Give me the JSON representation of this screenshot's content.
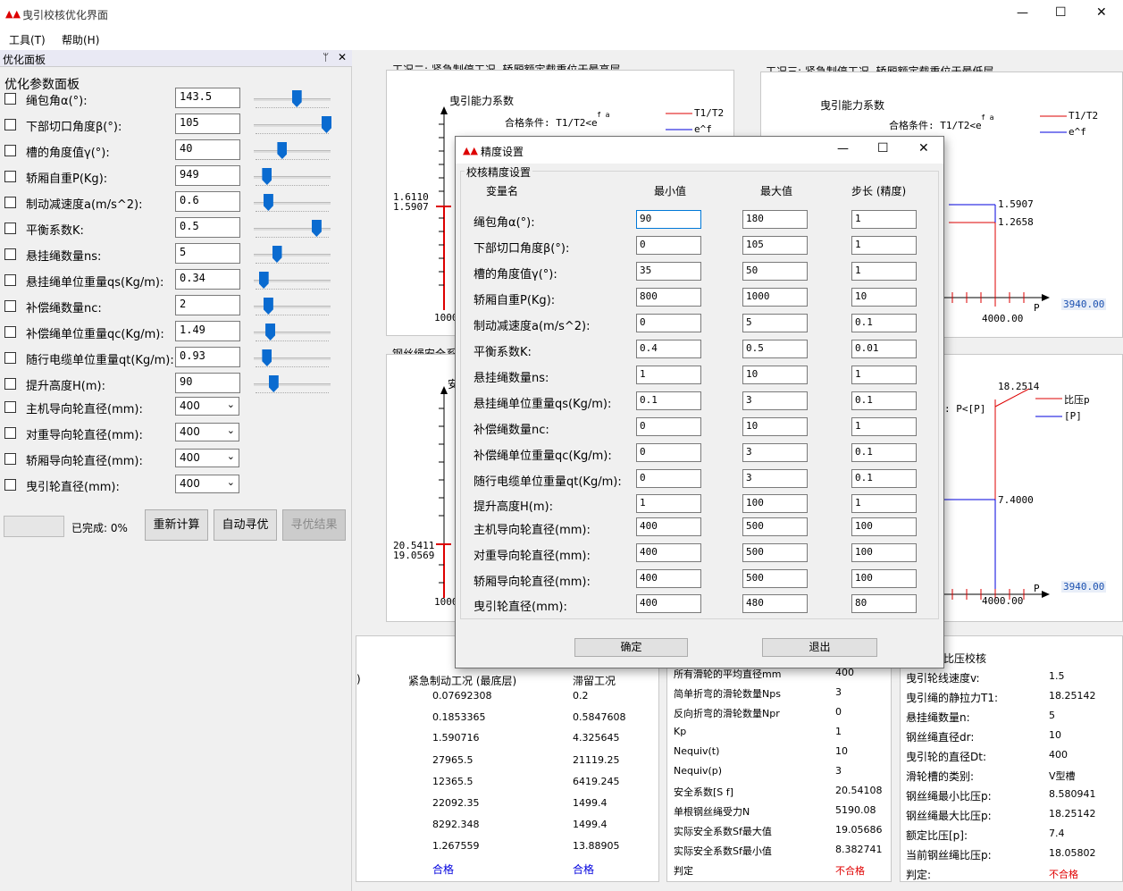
{
  "window": {
    "title": "曳引校核优化界面",
    "min": "—",
    "max": "☐",
    "close": "✕"
  },
  "menu": {
    "tools": "工具(T)",
    "help": "帮助(H)"
  },
  "panel": {
    "header": "优化面板",
    "pin": "ᛘ",
    "close": "✕",
    "group_title": "优化参数面板",
    "params": [
      {
        "label": "绳包角α(°):",
        "value": "143.5",
        "level": 0.55
      },
      {
        "label": "下部切口角度β(°):",
        "value": "105",
        "level": 1.0
      },
      {
        "label": "槽的角度值γ(°):",
        "value": "40",
        "level": 0.33
      },
      {
        "label": "轿厢自重P(Kg):",
        "value": "949",
        "level": 0.1
      },
      {
        "label": "制动减速度a(m/s^2):",
        "value": "0.6",
        "level": 0.12
      },
      {
        "label": "平衡系数K:",
        "value": "0.5",
        "level": 0.85
      },
      {
        "label": "悬挂绳数量ns:",
        "value": "5",
        "level": 0.25
      },
      {
        "label": "悬挂绳单位重量qs(Kg/m):",
        "value": "0.34",
        "level": 0.05
      },
      {
        "label": "补偿绳数量nc:",
        "value": "2",
        "level": 0.12
      },
      {
        "label": "补偿绳单位重量qc(Kg/m):",
        "value": "1.49",
        "level": 0.15
      },
      {
        "label": "随行电缆单位重量qt(Kg/m):",
        "value": "0.93",
        "level": 0.1
      },
      {
        "label": "提升高度H(m):",
        "value": "90",
        "level": 0.2
      }
    ],
    "selects": [
      {
        "label": "主机导向轮直径(mm):",
        "value": "400"
      },
      {
        "label": "对重导向轮直径(mm):",
        "value": "400"
      },
      {
        "label": "轿厢导向轮直径(mm):",
        "value": "400"
      },
      {
        "label": "曳引轮直径(mm):",
        "value": "400"
      }
    ],
    "progress_label": "已完成: 0%",
    "progress": 0,
    "btn_recalc": "重新计算",
    "btn_auto": "自动寻优",
    "btn_result": "寻优结果"
  },
  "charts": {
    "c2_title": "工况二: 紧急制停工况, 轿厢额定载重位于最高层",
    "c3_title": "工况三: 紧急制停工况, 轿厢额定载重位于最低层",
    "c4_title": "钢丝绳安全系",
    "c2_ylabel": "曳引能力系数",
    "c2_cond": "合格条件: T1/T2<e",
    "cond_sup": "f a",
    "c2_legend1": "T1/T2",
    "c2_legend2": "e^f",
    "c2_v1": "1.6110",
    "c2_v2": "1.5907",
    "c2_xtick": "1000",
    "c3_ylabel": "曳引能力系数",
    "c3_cond": "合格条件: T1/T2<e",
    "c3_legend1": "T1/T2",
    "c3_legend2": "e^f",
    "c3_v1": "1.5907",
    "c3_v2": "1.2658",
    "c3_xtick": "4000.00",
    "c3_xlabel": "P",
    "c3_side": "3940.00",
    "c4_v1": "20.5411",
    "c4_v2": "19.0569",
    "c4_xtick": "1000",
    "c4_ylabel": "安",
    "c5_v1": "18.2514",
    "c5_v2": "7.4000",
    "c5_cond": ": P<[P]",
    "c5_legend1": "比压p",
    "c5_legend2": "[P]",
    "c5_xtick": "4000.00",
    "c5_xlabel": "P",
    "c5_side": "3940.00"
  },
  "table1": {
    "hdr_a": ")",
    "hdr_b": "紧急制动工况 (最底层)",
    "hdr_c": "滞留工况",
    "col_b": [
      "0.07692308",
      "0.1853365",
      "1.590716",
      "27965.5",
      "12365.5",
      "22092.35",
      "8292.348",
      "1.267559"
    ],
    "col_c": [
      "0.2",
      "0.5847608",
      "4.325645",
      "21119.25",
      "6419.245",
      "1499.4",
      "1499.4",
      "13.88905"
    ],
    "res_b": "合格",
    "res_c": "合格"
  },
  "table2": {
    "rows": [
      {
        "k": "所有滑轮的平均直径mm",
        "v": "400"
      },
      {
        "k": "简单折弯的滑轮数量Nps",
        "v": "3"
      },
      {
        "k": "反向折弯的滑轮数量Npr",
        "v": "0"
      },
      {
        "k": "Kp",
        "v": "1"
      },
      {
        "k": "Nequiv(t)",
        "v": "10"
      },
      {
        "k": "Nequiv(p)",
        "v": "3"
      },
      {
        "k": "安全系数[S f]",
        "v": "20.54108"
      },
      {
        "k": "单根钢丝绳受力N",
        "v": "5190.08"
      },
      {
        "k": "实际安全系数Sf最大值",
        "v": "19.05686"
      },
      {
        "k": "实际安全系数Sf最小值",
        "v": "8.382741"
      },
      {
        "k": "判定",
        "v": "不合格"
      }
    ]
  },
  "table3": {
    "title": "比压校核",
    "rows": [
      {
        "k": "曳引轮线速度v:",
        "v": "1.5"
      },
      {
        "k": "曳引绳的静拉力T1:",
        "v": "18.25142"
      },
      {
        "k": "悬挂绳数量n:",
        "v": "5"
      },
      {
        "k": "钢丝绳直径dr:",
        "v": "10"
      },
      {
        "k": "曳引轮的直径Dt:",
        "v": "400"
      },
      {
        "k": "滑轮槽的类别:",
        "v": "V型槽"
      },
      {
        "k": "钢丝绳最小比压p:",
        "v": "8.580941"
      },
      {
        "k": "钢丝绳最大比压p:",
        "v": "18.25142"
      },
      {
        "k": "额定比压[p]:",
        "v": "7.4"
      },
      {
        "k": "当前钢丝绳比压p:",
        "v": "18.05802"
      },
      {
        "k": "判定:",
        "v": "不合格"
      }
    ]
  },
  "dialog": {
    "title": "精度设置",
    "min": "—",
    "max": "☐",
    "close": "✕",
    "group": "校核精度设置",
    "hdr_name": "变量名",
    "hdr_min": "最小值",
    "hdr_max": "最大值",
    "hdr_step": "步长 (精度)",
    "rows": [
      {
        "label": "绳包角α(°):",
        "min": "90",
        "max": "180",
        "step": "1"
      },
      {
        "label": "下部切口角度β(°):",
        "min": "0",
        "max": "105",
        "step": "1"
      },
      {
        "label": "槽的角度值γ(°):",
        "min": "35",
        "max": "50",
        "step": "1"
      },
      {
        "label": "轿厢自重P(Kg):",
        "min": "800",
        "max": "1000",
        "step": "10"
      },
      {
        "label": "制动减速度a(m/s^2):",
        "min": "0",
        "max": "5",
        "step": "0.1"
      },
      {
        "label": "平衡系数K:",
        "min": "0.4",
        "max": "0.5",
        "step": "0.01"
      },
      {
        "label": "悬挂绳数量ns:",
        "min": "1",
        "max": "10",
        "step": "1"
      },
      {
        "label": "悬挂绳单位重量qs(Kg/m):",
        "min": "0.1",
        "max": "3",
        "step": "0.1"
      },
      {
        "label": "补偿绳数量nc:",
        "min": "0",
        "max": "10",
        "step": "1"
      },
      {
        "label": "补偿绳单位重量qc(Kg/m):",
        "min": "0",
        "max": "3",
        "step": "0.1"
      },
      {
        "label": "随行电缆单位重量qt(Kg/m):",
        "min": "0",
        "max": "3",
        "step": "0.1"
      },
      {
        "label": "提升高度H(m):",
        "min": "1",
        "max": "100",
        "step": "1"
      },
      {
        "label": "主机导向轮直径(mm):",
        "min": "400",
        "max": "500",
        "step": "100"
      },
      {
        "label": "对重导向轮直径(mm):",
        "min": "400",
        "max": "500",
        "step": "100"
      },
      {
        "label": "轿厢导向轮直径(mm):",
        "min": "400",
        "max": "500",
        "step": "100"
      },
      {
        "label": "曳引轮直径(mm):",
        "min": "400",
        "max": "480",
        "step": "80"
      }
    ],
    "ok": "确定",
    "exit": "退出"
  },
  "colors": {
    "accent": "#0a6bd0",
    "red": "#e00000",
    "blue": "#0000dd"
  }
}
